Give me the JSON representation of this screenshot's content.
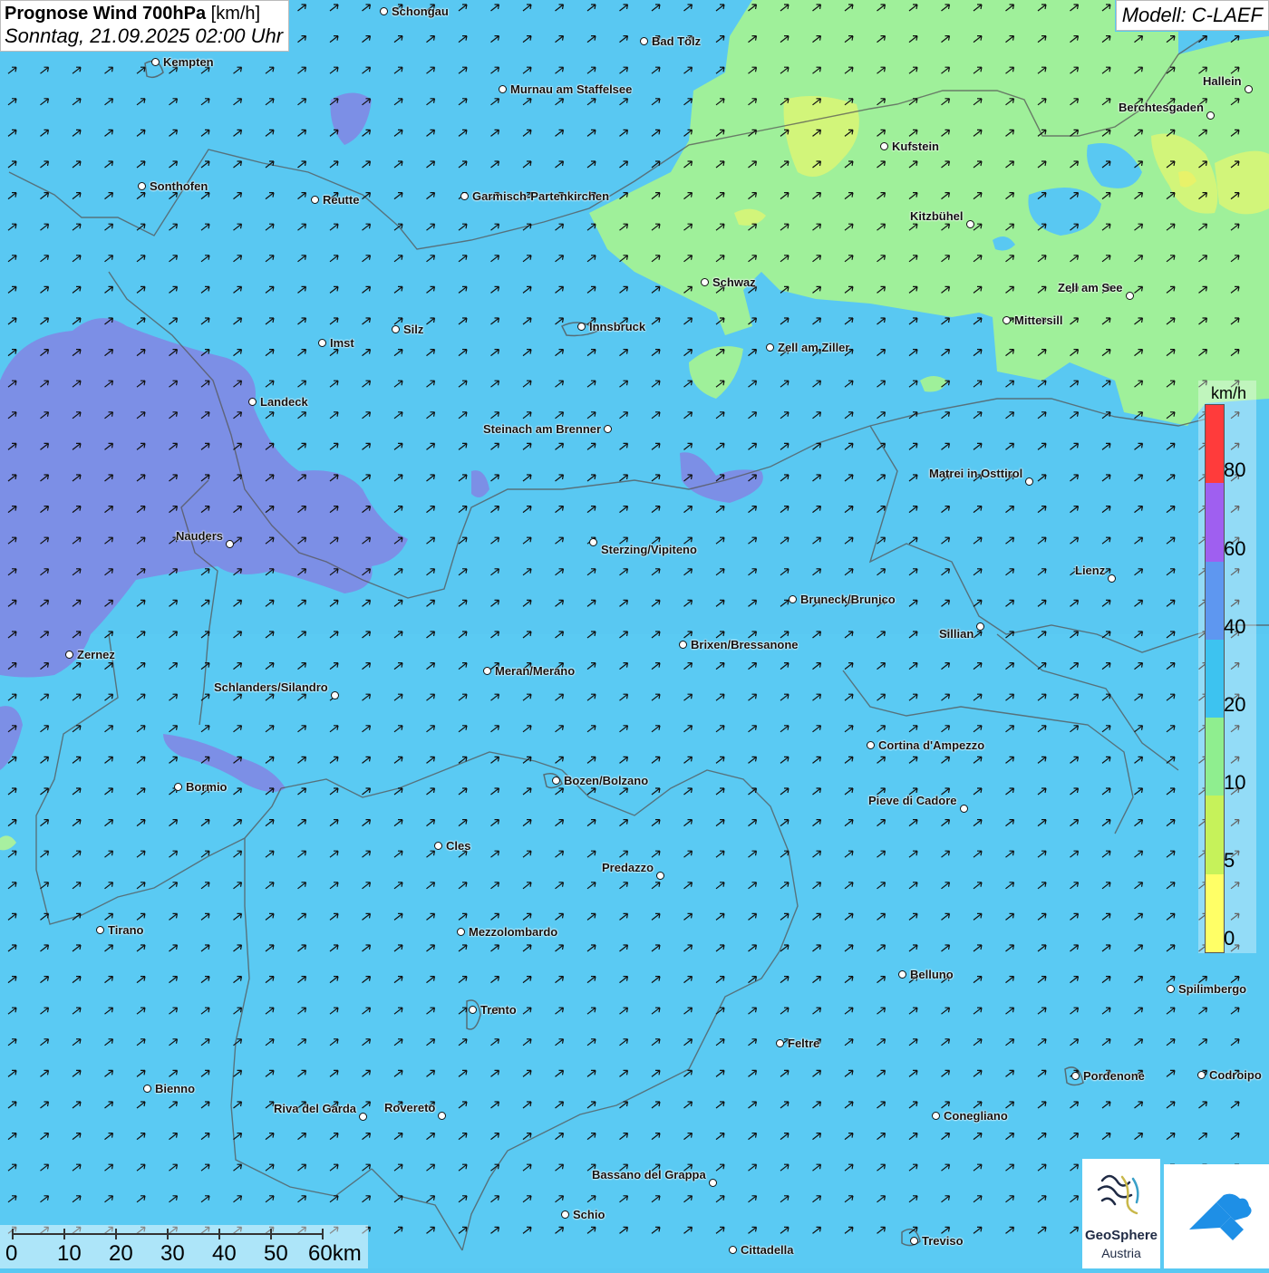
{
  "title": {
    "main": "Prognose Wind 700hPa",
    "unit": "[km/h]",
    "datetime": "Sonntag, 21.09.2025 02:00 Uhr"
  },
  "model": "Modell: C-LAEF",
  "legend": {
    "unit": "km/h",
    "labels": [
      "80",
      "60",
      "40",
      "20",
      "10",
      "5",
      "0"
    ],
    "colors": [
      "#ff3b3b",
      "#9f5ff0",
      "#5e97f0",
      "#3dc3f0",
      "#8fee8f",
      "#c6f25a",
      "#ffff66"
    ]
  },
  "scale_bar": {
    "labels": [
      "0",
      "10",
      "20",
      "30",
      "40",
      "50",
      "60km"
    ]
  },
  "logos": {
    "geosphere_name": "GeoSphere",
    "geosphere_sub": "Austria"
  },
  "wind_direction": "from south-west (arrows pointing north-east)",
  "cities": [
    {
      "name": "Schongau"
    },
    {
      "name": "Bad Tölz"
    },
    {
      "name": "Kempten"
    },
    {
      "name": "Murnau am Staffelsee"
    },
    {
      "name": "Hallein"
    },
    {
      "name": "Berchtesgaden"
    },
    {
      "name": "Kufstein"
    },
    {
      "name": "Sonthofen"
    },
    {
      "name": "Reutte"
    },
    {
      "name": "Garmisch-Partenkirchen"
    },
    {
      "name": "Kitzbühel"
    },
    {
      "name": "Schwaz"
    },
    {
      "name": "Zell am See"
    },
    {
      "name": "Mittersill"
    },
    {
      "name": "Imst"
    },
    {
      "name": "Silz"
    },
    {
      "name": "Innsbruck"
    },
    {
      "name": "Zell am Ziller"
    },
    {
      "name": "Landeck"
    },
    {
      "name": "Steinach am Brenner"
    },
    {
      "name": "Matrei in Osttirol"
    },
    {
      "name": "Nauders"
    },
    {
      "name": "Sterzing/Vipiteno"
    },
    {
      "name": "Lienz"
    },
    {
      "name": "Bruneck/Brunico"
    },
    {
      "name": "Sillian"
    },
    {
      "name": "Brixen/Bressanone"
    },
    {
      "name": "Zernez"
    },
    {
      "name": "Meran/Merano"
    },
    {
      "name": "Schlanders/Silandro"
    },
    {
      "name": "Cortina d'Ampezzo"
    },
    {
      "name": "Bozen/Bolzano"
    },
    {
      "name": "Bormio"
    },
    {
      "name": "Pieve di Cadore"
    },
    {
      "name": "Cles"
    },
    {
      "name": "Predazzo"
    },
    {
      "name": "Tirano"
    },
    {
      "name": "Mezzolombardo"
    },
    {
      "name": "Belluno"
    },
    {
      "name": "Spilimbergo"
    },
    {
      "name": "Trento"
    },
    {
      "name": "Feltre"
    },
    {
      "name": "Pordenone"
    },
    {
      "name": "Codroipo"
    },
    {
      "name": "Bienno"
    },
    {
      "name": "Riva del Garda"
    },
    {
      "name": "Rovereto"
    },
    {
      "name": "Conegliano"
    },
    {
      "name": "Bassano del Grappa"
    },
    {
      "name": "Schio"
    },
    {
      "name": "Treviso"
    },
    {
      "name": "Cittadella"
    }
  ]
}
